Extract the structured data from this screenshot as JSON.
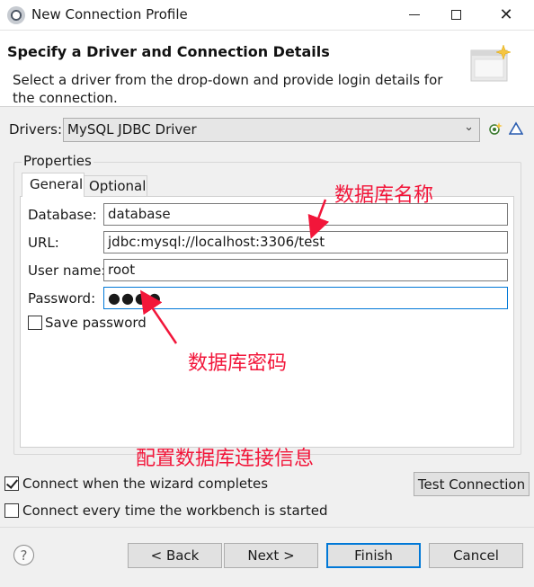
{
  "window": {
    "title": "New Connection Profile",
    "controls": {
      "minimize_icon": "minimize-icon",
      "maximize_icon": "maximize-icon",
      "close_symbol": "✕"
    }
  },
  "header": {
    "title": "Specify a Driver and Connection Details",
    "description": "Select a driver from the drop-down and provide login details for the connection."
  },
  "drivers": {
    "label": "Drivers:",
    "selected": "MySQL JDBC Driver",
    "dropdown_icon": "chevron-down-icon",
    "tool_icons": [
      "new-driver-icon",
      "edit-driver-icon"
    ]
  },
  "properties": {
    "group_label": "Properties",
    "tabs": [
      {
        "label": "General",
        "active": true
      },
      {
        "label": "Optional",
        "active": false
      }
    ],
    "fields": {
      "database": {
        "label": "Database:",
        "value": "database"
      },
      "url": {
        "label": "URL:",
        "value": "jdbc:mysql://localhost:3306/test"
      },
      "username": {
        "label": "User name:",
        "value": "root"
      },
      "password": {
        "label": "Password:",
        "value": "●●●●"
      }
    },
    "save_password": {
      "label": "Save password",
      "checked": false
    }
  },
  "annotations": {
    "database_name": "数据库名称",
    "database_password": "数据库密码",
    "config_info": "配置数据库连接信息",
    "color": "#f2163a"
  },
  "options": {
    "connect_on_complete": {
      "label": "Connect when the wizard completes",
      "checked": true
    },
    "connect_every_time": {
      "label": "Connect every time the workbench is started",
      "checked": false
    }
  },
  "buttons": {
    "test_connection": "Test Connection",
    "back": "< Back",
    "next": "Next >",
    "finish": "Finish",
    "cancel": "Cancel",
    "help_symbol": "?"
  },
  "colors": {
    "accent": "#0078d7",
    "annotation": "#f2163a",
    "dialog_bg": "#f0f0f0"
  }
}
